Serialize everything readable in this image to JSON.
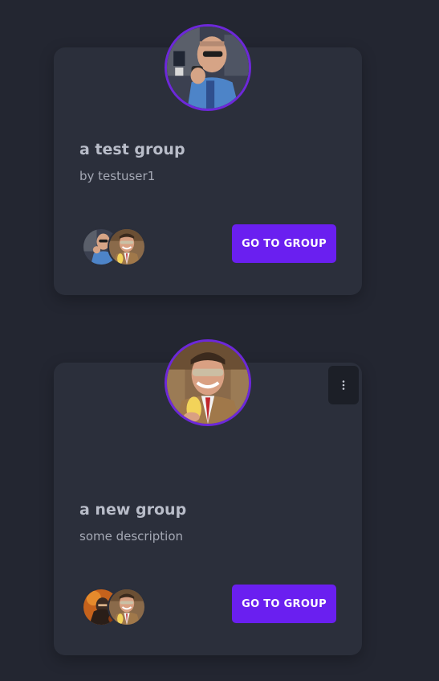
{
  "groups": [
    {
      "title": "a test group",
      "subtitle": "by testuser1",
      "cover_image": "man-with-camera-photo",
      "members": [
        "member-avatar-camera-man",
        "member-avatar-smiling-man"
      ],
      "button_label": "GO TO GROUP"
    },
    {
      "title": "a new group",
      "subtitle": "some description",
      "cover_image": "smiling-man-photo",
      "members": [
        "member-avatar-orange-photo",
        "member-avatar-smiling-man"
      ],
      "button_label": "GO TO GROUP",
      "menu_icon": "kebab-menu-icon"
    }
  ],
  "colors": {
    "background": "#232631",
    "card": "#2b2f3b",
    "accent": "#6a1ff0",
    "avatar_ring": "#6d28d9"
  }
}
